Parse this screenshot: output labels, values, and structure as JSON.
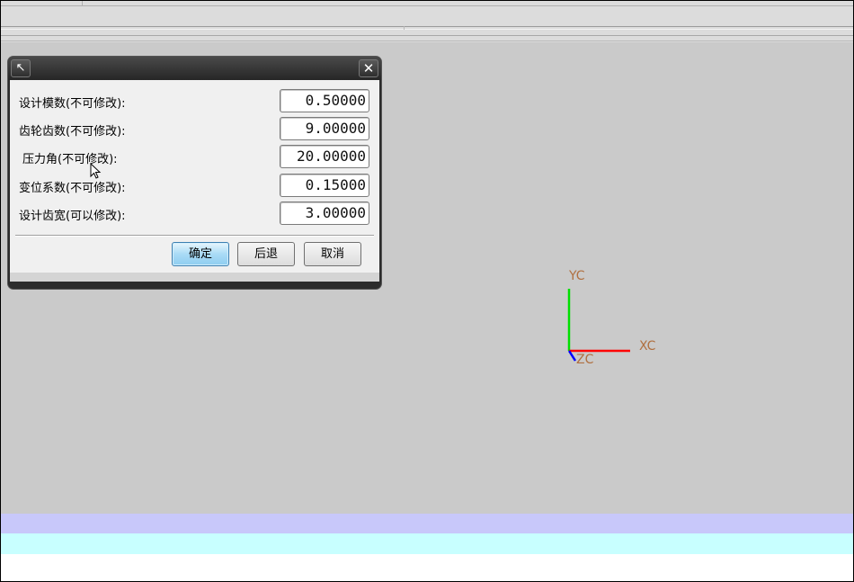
{
  "dialog": {
    "pin_glyph": "↖",
    "close_glyph": "✕",
    "rows": [
      {
        "label": "设计模数(不可修改):",
        "value": "0.50000"
      },
      {
        "label": "齿轮齿数(不可修改):",
        "value": "9.00000"
      },
      {
        "label": "压力角(不可修改):",
        "value": "20.00000"
      },
      {
        "label": "变位系数(不可修改):",
        "value": "0.15000"
      },
      {
        "label": "设计齿宽(可以修改):",
        "value": "3.00000"
      }
    ],
    "buttons": {
      "ok": "确定",
      "back": "后退",
      "cancel": "取消"
    }
  },
  "triad": {
    "x_label": "XC",
    "y_label": "YC",
    "z_label": "ZC",
    "label_color": "#b07040",
    "x_color": "#ff0000",
    "y_color": "#00e000",
    "z_color": "#0000ff"
  },
  "colors": {
    "viewport": "#cacaca",
    "status_band_1": "#c8c8fa",
    "status_band_2": "#c8ffff"
  }
}
